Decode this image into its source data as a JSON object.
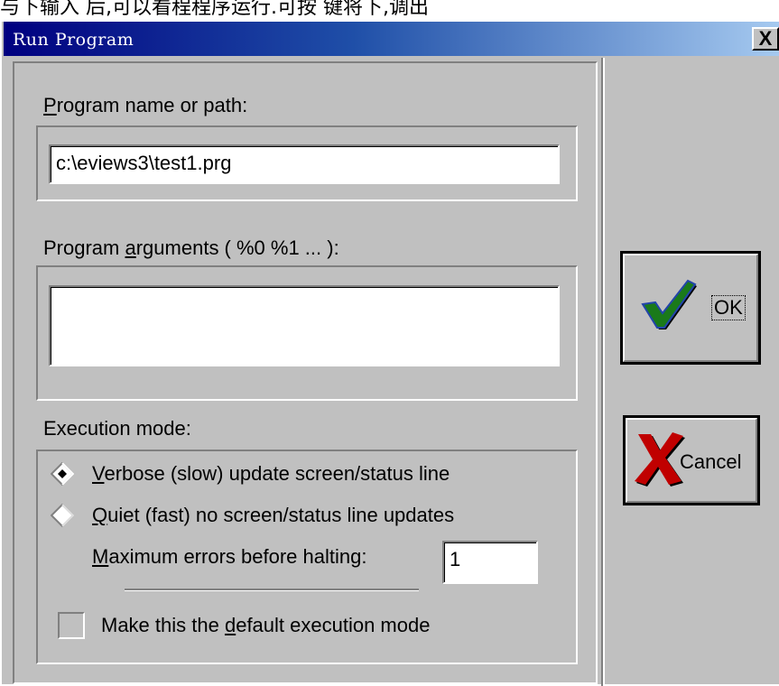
{
  "background_text": "与下输入          后,可以看程程序运行.可按    键将下,调出",
  "dialog": {
    "title": "Run Program",
    "close_label": "X",
    "program_name": {
      "label_accel": "P",
      "label_rest": "rogram name or path:",
      "value": "c:\\eviews3\\test1.prg"
    },
    "program_args": {
      "label_before": "Program ",
      "label_accel": "a",
      "label_after": "rguments ( %0  %1 ... ):",
      "value": ""
    },
    "execution": {
      "label": "Execution mode:",
      "verbose": {
        "accel": "V",
        "rest": "erbose (slow) update screen/status line",
        "selected": true
      },
      "quiet": {
        "accel": "Q",
        "rest": "uiet (fast) no screen/status line updates",
        "selected": false
      },
      "max_errors": {
        "accel": "M",
        "rest": "aximum errors before halting:",
        "value": "1"
      },
      "default_mode": {
        "before": "Make this the ",
        "accel": "d",
        "after": "efault execution mode",
        "checked": false
      }
    },
    "buttons": {
      "ok": "OK",
      "cancel": "Cancel"
    },
    "colors": {
      "face": "#c0c0c0",
      "title_start": "#000080",
      "title_end": "#a6caf0",
      "ok_check": "#1a7a1a",
      "cancel_x": "#c00000"
    }
  }
}
